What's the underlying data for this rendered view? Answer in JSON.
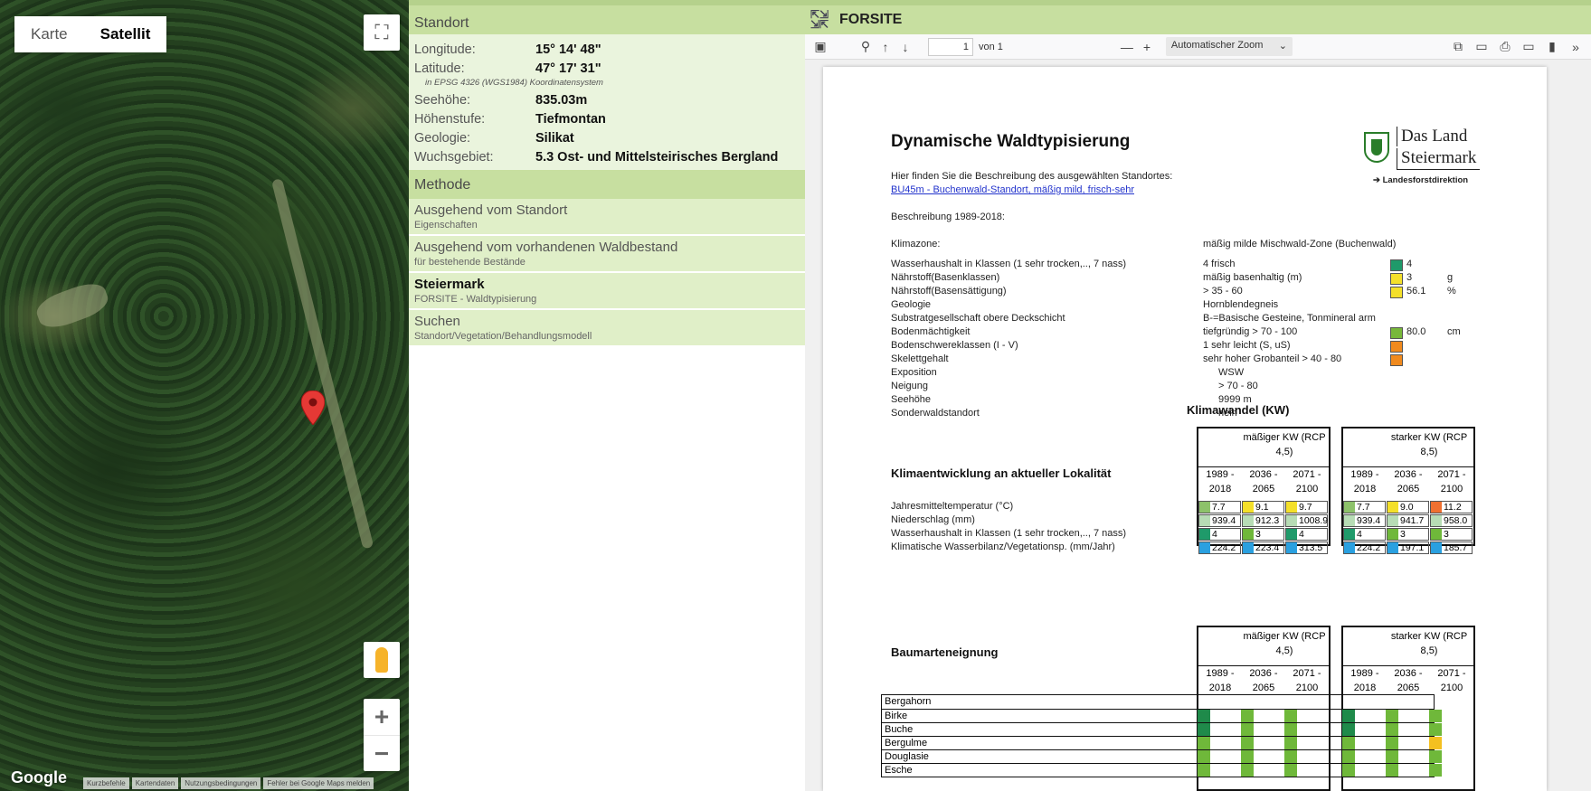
{
  "map": {
    "type_map": "Karte",
    "type_satellite": "Satellit",
    "logo": "Google",
    "attributions": [
      "Kurzbefehle",
      "Kartendaten",
      "Nutzungsbedingungen",
      "Fehler bei Google Maps melden"
    ]
  },
  "standort": {
    "header": "Standort",
    "longitude_label": "Longitude:",
    "longitude": "15° 14' 48\"",
    "latitude_label": "Latitude:",
    "latitude": "47° 17' 31\"",
    "epsg": "in EPSG 4326 (WGS1984) Koordinatensystem",
    "seehoehe_label": "Seehöhe:",
    "seehoehe": "835.03m",
    "hoehenstufe_label": "Höhenstufe:",
    "hoehenstufe": "Tiefmontan",
    "geologie_label": "Geologie:",
    "geologie": "Silikat",
    "wuchsgebiet_label": "Wuchsgebiet:",
    "wuchsgebiet": "5.3 Ost- und Mittelsteirisches Bergland"
  },
  "methode": {
    "header": "Methode",
    "items": [
      {
        "title": "Ausgehend vom Standort",
        "sub": "Eigenschaften"
      },
      {
        "title": "Ausgehend vom vorhandenen Waldbestand",
        "sub": "für bestehende Bestände"
      },
      {
        "title": "Steiermark",
        "sub": "FORSITE - Waldtypisierung"
      },
      {
        "title": "Suchen",
        "sub": "Standort/Vegetation/Behandlungsmodell"
      }
    ]
  },
  "viewer": {
    "title": "FORSITE",
    "page": "1",
    "of": "von 1",
    "zoom": "Automatischer Zoom"
  },
  "pdf": {
    "title": "Dynamische Waldtypisierung",
    "logo_line1": "Das Land",
    "logo_line2": "Steiermark",
    "logo_line3": "➔ Landesforstdirektion",
    "intro": "Hier finden Sie die Beschreibung des ausgewählten Standortes:",
    "link": "BU45m - Buchenwald-Standort, mäßig mild, frisch-sehr",
    "period": "Beschreibung 1989-2018:",
    "klimazone_label": "Klimazone:",
    "klimazone": "mäßig milde Mischwald-Zone (Buchenwald)",
    "attributes": [
      {
        "label": "Wasserhaushalt in Klassen (1 sehr trocken,.., 7 nass)",
        "value": "4 frisch",
        "swatch": "#1f9a6a",
        "num": "4",
        "unit": ""
      },
      {
        "label": "Nährstoff(Basenklassen)",
        "value": "mäßig basenhaltig (m)",
        "swatch": "#f4e02a",
        "num": "3",
        "unit": "g"
      },
      {
        "label": "Nährstoff(Basensättigung)",
        "value": "> 35 - 60",
        "swatch": "#f4e02a",
        "num": "56.1",
        "unit": "%"
      },
      {
        "label": "Geologie",
        "value": "Hornblendegneis",
        "swatch": "",
        "num": "",
        "unit": ""
      },
      {
        "label": "Substratgesellschaft obere Deckschicht",
        "value": "B-=Basische Gesteine, Tonmineral arm",
        "swatch": "",
        "num": "",
        "unit": ""
      },
      {
        "label": "Bodenmächtigkeit",
        "value": "tiefgründig > 70 - 100",
        "swatch": "#78b83a",
        "num": "80.0",
        "unit": "cm"
      },
      {
        "label": "Bodenschwereklassen (I - V)",
        "value": "1  sehr leicht (S, uS)",
        "swatch": "#f08a1e",
        "num": "",
        "unit": ""
      },
      {
        "label": "Skelettgehalt",
        "value": "sehr hoher Grobanteil > 40 - 80",
        "swatch": "#f08a1e",
        "num": "",
        "unit": ""
      },
      {
        "label": "Exposition",
        "value": "WSW",
        "swatch": "",
        "num": "",
        "unit": ""
      },
      {
        "label": "Neigung",
        "value": "> 70 - 80",
        "swatch": "",
        "num": "",
        "unit": ""
      },
      {
        "label": "Seehöhe",
        "value": "9999  m",
        "swatch": "",
        "num": "",
        "unit": ""
      },
      {
        "label": "Sonderwaldstandort",
        "value": "nein",
        "swatch": "",
        "num": "",
        "unit": ""
      }
    ],
    "klimawandel": "Klimawandel (KW)",
    "klimaentwicklung": "Klimaentwicklung an aktueller Lokalität",
    "baumarten": "Baumarteneignung",
    "kw_moderate": "mäßiger KW (RCP 4,5)",
    "kw_strong": "starker KW (RCP 8,5)",
    "periods": [
      "1989 - 2018",
      "2036 - 2065",
      "2071 - 2100"
    ],
    "climate_rows": [
      {
        "label": "Jahresmitteltemperatur (°C)",
        "mod": [
          "7.7",
          "9.1",
          "9.7"
        ],
        "str": [
          "7.7",
          "9.0",
          "11.2"
        ],
        "mod_c": [
          "#8dc26a",
          "#f4e02a",
          "#f4e02a"
        ],
        "str_c": [
          "#8dc26a",
          "#f4e02a",
          "#f07030"
        ]
      },
      {
        "label": "Niederschlag (mm)",
        "mod": [
          "939.4",
          "912.3",
          "1008.9"
        ],
        "str": [
          "939.4",
          "941.7",
          "958.0"
        ],
        "mod_c": [
          "#b7dcb5",
          "#b7dcb5",
          "#b7dcb5"
        ],
        "str_c": [
          "#b7dcb5",
          "#b7dcb5",
          "#b7dcb5"
        ]
      },
      {
        "label": "Wasserhaushalt in Klassen (1 sehr trocken,.., 7 nass)",
        "mod": [
          "4",
          "3",
          "4"
        ],
        "str": [
          "4",
          "3",
          "3"
        ],
        "mod_c": [
          "#1f9a6a",
          "#6fb83a",
          "#1f9a6a"
        ],
        "str_c": [
          "#1f9a6a",
          "#6fb83a",
          "#6fb83a"
        ]
      },
      {
        "label": "Klimatische Wasserbilanz/Vegetationsp. (mm/Jahr)",
        "mod": [
          "224.2",
          "223.4",
          "313.5"
        ],
        "str": [
          "224.2",
          "197.1",
          "185.7"
        ],
        "mod_c": [
          "#2aa0e0",
          "#2aa0e0",
          "#2aa0e0"
        ],
        "str_c": [
          "#2aa0e0",
          "#2aa0e0",
          "#2aa0e0"
        ]
      }
    ],
    "trees": [
      {
        "name": "Bergahorn",
        "c": [
          "",
          "",
          "",
          "",
          "",
          ""
        ]
      },
      {
        "name": "Birke",
        "c": [
          "#1f8a4a",
          "#6fb83a",
          "#6fb83a",
          "#1f8a4a",
          "#6fb83a",
          "#6fb83a"
        ]
      },
      {
        "name": "Buche",
        "c": [
          "#1f8a4a",
          "#6fb83a",
          "#6fb83a",
          "#1f8a4a",
          "#6fb83a",
          "#6fb83a"
        ]
      },
      {
        "name": "Bergulme",
        "c": [
          "#6fb83a",
          "#6fb83a",
          "#6fb83a",
          "#6fb83a",
          "#6fb83a",
          "#f4c020"
        ]
      },
      {
        "name": "Douglasie",
        "c": [
          "#6fb83a",
          "#6fb83a",
          "#6fb83a",
          "#6fb83a",
          "#6fb83a",
          "#6fb83a"
        ]
      },
      {
        "name": "Esche",
        "c": [
          "#6fb83a",
          "#6fb83a",
          "#6fb83a",
          "#6fb83a",
          "#6fb83a",
          "#6fb83a"
        ]
      }
    ]
  }
}
